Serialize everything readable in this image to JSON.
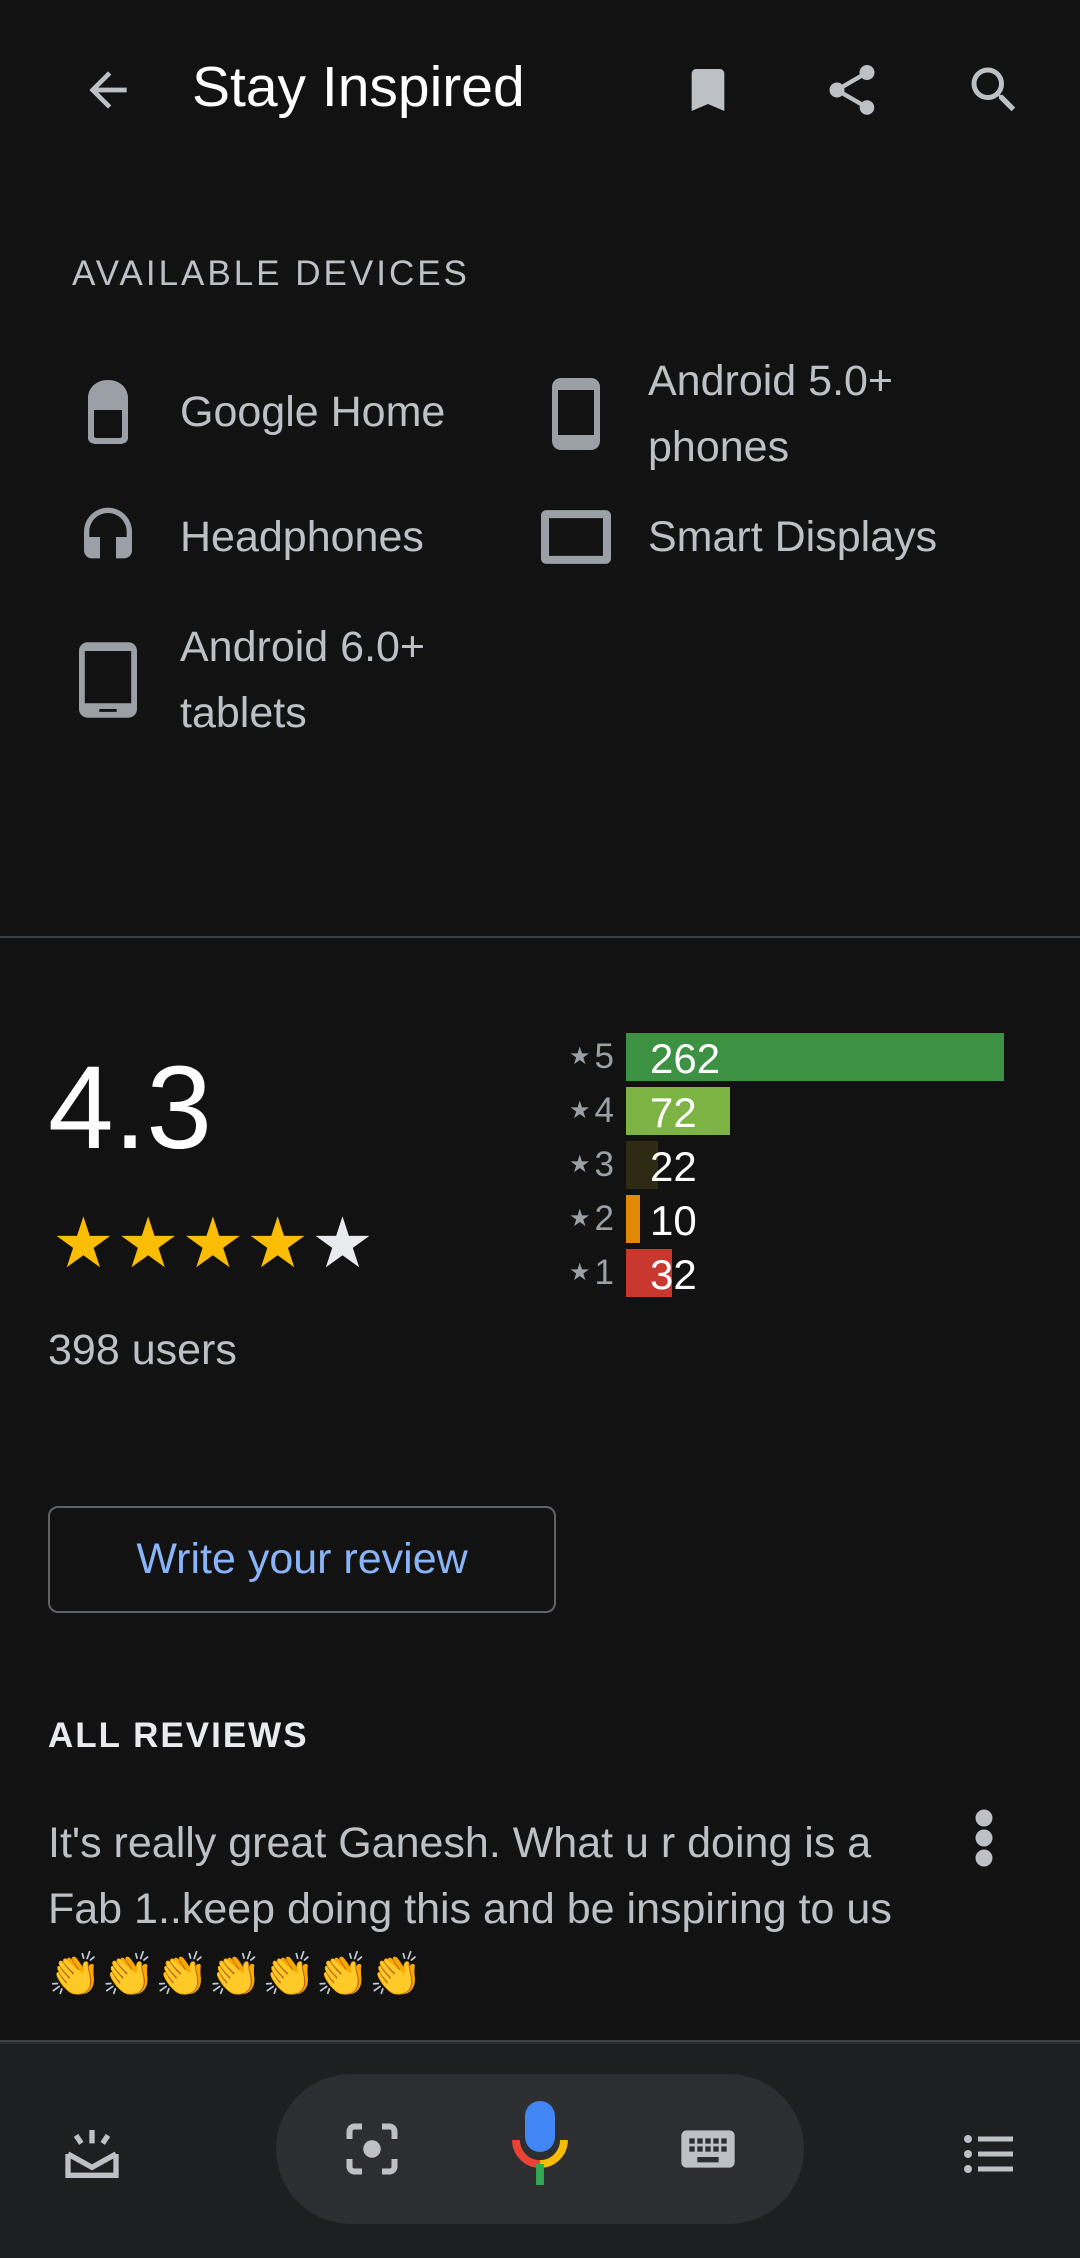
{
  "header": {
    "title": "Stay Inspired",
    "icons": [
      "back-arrow-icon",
      "bookmark-icon",
      "share-icon",
      "search-icon"
    ]
  },
  "devices": {
    "heading": "AVAILABLE DEVICES",
    "items": [
      {
        "label": "Google Home",
        "icon": "google-home-icon"
      },
      {
        "label": "Android 5.0+ phones",
        "icon": "phone-icon"
      },
      {
        "label": "Headphones",
        "icon": "headphones-icon"
      },
      {
        "label": "Smart Displays",
        "icon": "smart-display-icon"
      },
      {
        "label": "Android 6.0+ tablets",
        "icon": "tablet-icon"
      }
    ]
  },
  "rating": {
    "score": "4.3",
    "stars_filled": 4,
    "stars_total": 5,
    "users": "398 users",
    "histogram": [
      {
        "star": "5",
        "count": "262",
        "value": 262,
        "color": "#3c9142"
      },
      {
        "star": "4",
        "count": "72",
        "value": 72,
        "color": "#7cb342"
      },
      {
        "star": "3",
        "count": "22",
        "value": 22,
        "color": "#2e2a14"
      },
      {
        "star": "2",
        "count": "10",
        "value": 10,
        "color": "#e28a06"
      },
      {
        "star": "1",
        "count": "32",
        "value": 32,
        "color": "#c8382e"
      }
    ],
    "colors": {
      "star_filled": "#fbbc04",
      "star_empty": "#e8eaed"
    }
  },
  "review_button": {
    "label": "Write your review",
    "color": "#8ab4f8"
  },
  "reviews": {
    "heading": "ALL REVIEWS",
    "items": [
      {
        "text": "It's really great Ganesh. What u r doing is a Fab 1..keep doing this and be inspiring to us 👏👏👏👏👏👏👏"
      }
    ]
  },
  "bottom_bar": {
    "icons": [
      "snapshot-icon",
      "lens-icon",
      "mic-icon",
      "keyboard-icon",
      "list-icon"
    ]
  }
}
